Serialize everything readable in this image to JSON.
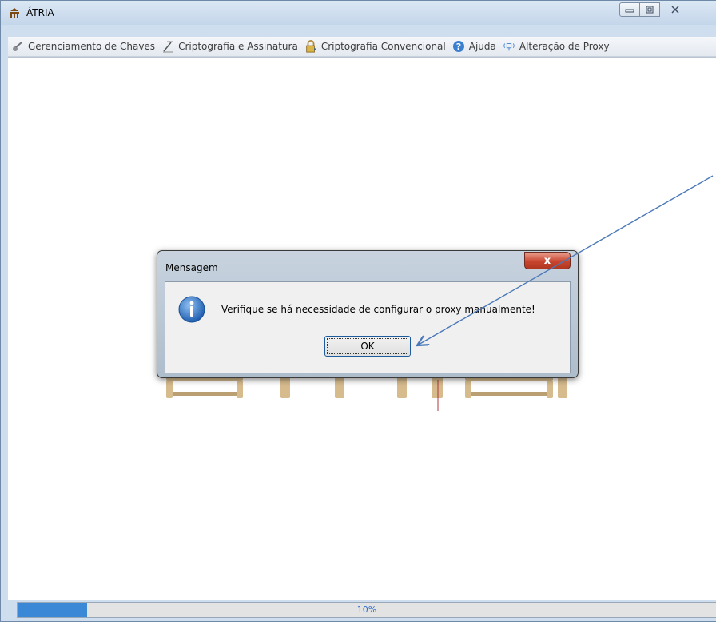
{
  "window": {
    "title": "ÁTRIA",
    "controls": {
      "minimize": "minimize",
      "maximize": "maximize",
      "close": "close"
    }
  },
  "menubar": {
    "items": [
      {
        "label": "Gerenciamento de Chaves",
        "icon": "key-icon"
      },
      {
        "label": "Criptografia e Assinatura",
        "icon": "pen-icon"
      },
      {
        "label": "Criptografia Convencional",
        "icon": "padlock-icon"
      },
      {
        "label": "Ajuda",
        "icon": "help-icon"
      },
      {
        "label": "Alteração de Proxy",
        "icon": "network-icon"
      }
    ]
  },
  "dialog": {
    "title": "Mensagem",
    "message": "Verifique se há necessidade de configurar o proxy manualmente!",
    "ok_label": "OK",
    "close_label": "x"
  },
  "progress": {
    "value": 0.1,
    "text": "10%"
  },
  "colors": {
    "accent": "#3a88d6",
    "arrow": "#4a78b8",
    "close_button": "#c8452f"
  }
}
